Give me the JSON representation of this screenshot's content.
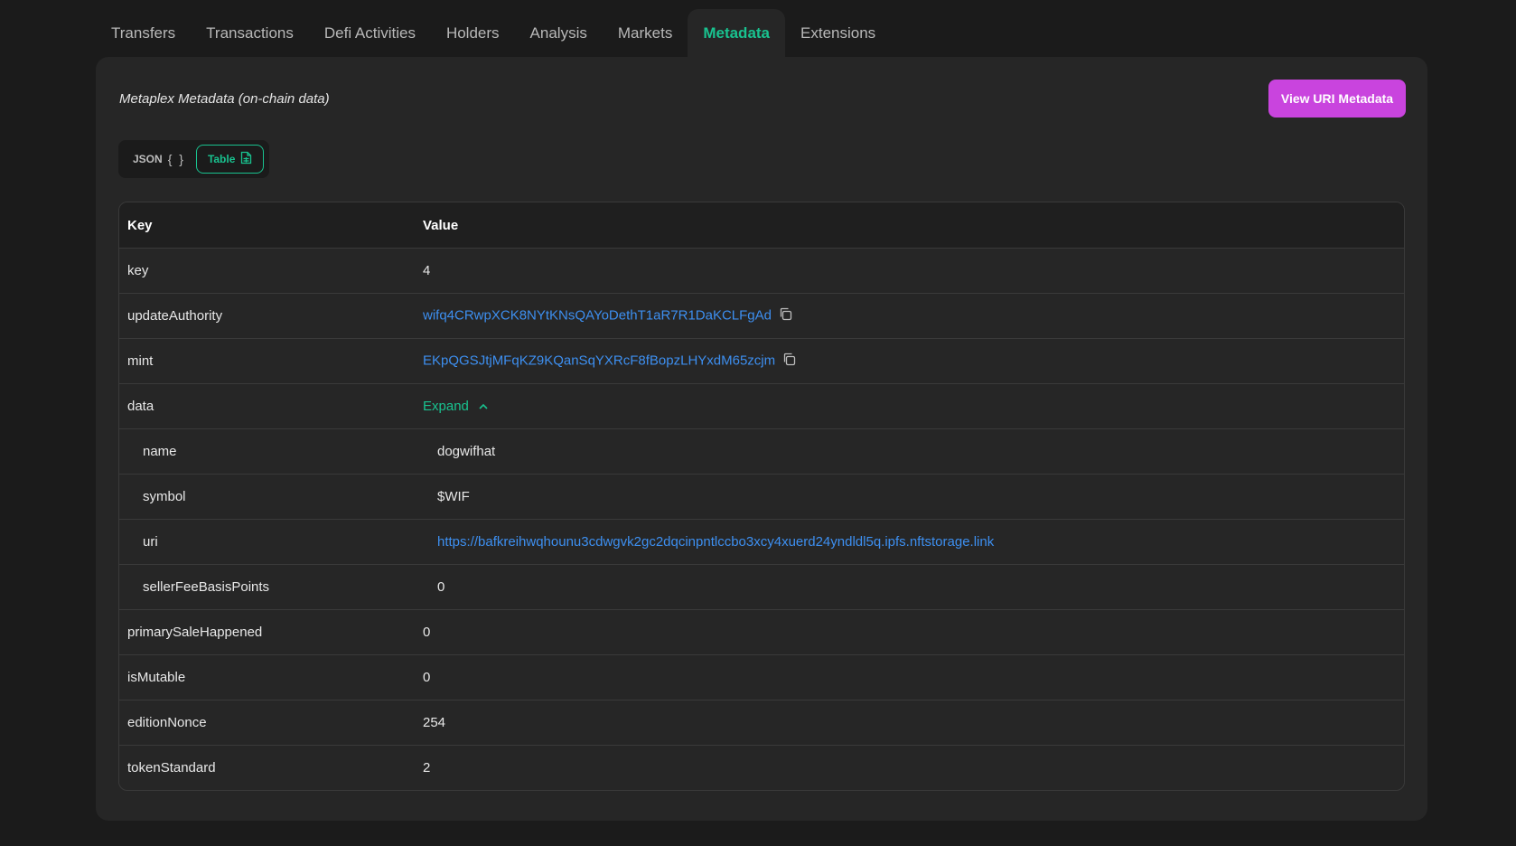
{
  "tabs": [
    {
      "label": "Transfers",
      "active": false
    },
    {
      "label": "Transactions",
      "active": false
    },
    {
      "label": "Defi Activities",
      "active": false
    },
    {
      "label": "Holders",
      "active": false
    },
    {
      "label": "Analysis",
      "active": false
    },
    {
      "label": "Markets",
      "active": false
    },
    {
      "label": "Metadata",
      "active": true
    },
    {
      "label": "Extensions",
      "active": false
    }
  ],
  "panel": {
    "title": "Metaplex Metadata (on-chain data)",
    "uri_button": "View URI Metadata"
  },
  "toggle": {
    "json_label": "JSON",
    "json_icon": "{ }",
    "table_label": "Table"
  },
  "table": {
    "headers": {
      "key": "Key",
      "value": "Value"
    },
    "rows": {
      "key": {
        "key": "key",
        "value": "4"
      },
      "updateAuthority": {
        "key": "updateAuthority",
        "value": "wifq4CRwpXCK8NYtKNsQAYoDethT1aR7R1DaKCLFgAd"
      },
      "mint": {
        "key": "mint",
        "value": "EKpQGSJtjMFqKZ9KQanSqYXRcF8fBopzLHYxdM65zcjm"
      },
      "data": {
        "key": "data",
        "value": "Expand"
      },
      "name": {
        "key": "name",
        "value": "dogwifhat"
      },
      "symbol": {
        "key": "symbol",
        "value": "$WIF"
      },
      "uri": {
        "key": "uri",
        "value": "https://bafkreihwqhounu3cdwgvk2gc2dqcinpntlccbo3xcy4xuerd24yndldl5q.ipfs.nftstorage.link"
      },
      "sellerFeeBasisPoints": {
        "key": "sellerFeeBasisPoints",
        "value": "0"
      },
      "primarySaleHappened": {
        "key": "primarySaleHappened",
        "value": "0"
      },
      "isMutable": {
        "key": "isMutable",
        "value": "0"
      },
      "editionNonce": {
        "key": "editionNonce",
        "value": "254"
      },
      "tokenStandard": {
        "key": "tokenStandard",
        "value": "2"
      }
    }
  },
  "colors": {
    "accent_green": "#19c28f",
    "link_blue": "#3d8ff0",
    "button_magenta": "#c944de",
    "background": "#1b1b1b",
    "panel": "#262626"
  }
}
